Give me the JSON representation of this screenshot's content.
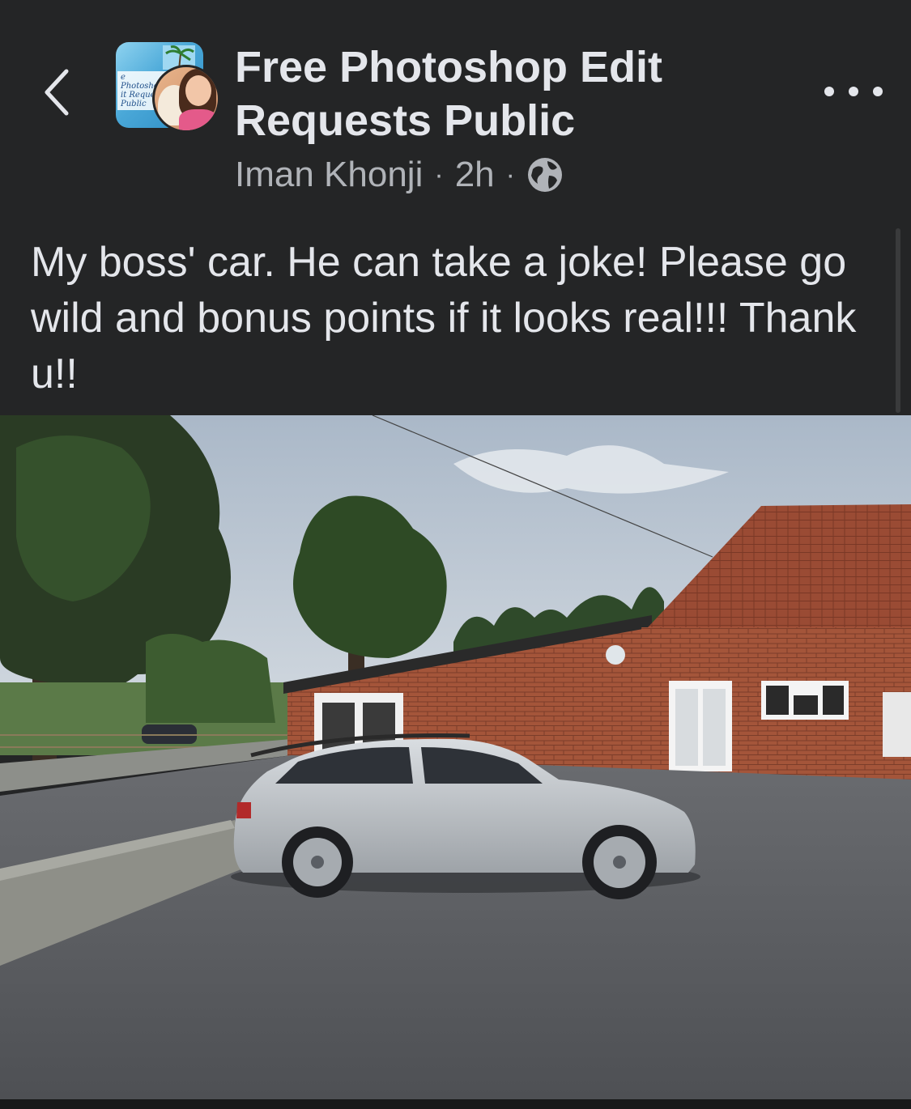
{
  "header": {
    "back_icon": "chevron-left-icon",
    "group_name": "Free Photoshop Edit Requests Public",
    "group_avatar_text": "e Photoshop\nit Request\nPublic",
    "author": "Iman Khonji",
    "separator": "·",
    "time": "2h",
    "audience_icon": "globe-icon",
    "more_icon": "more-horizontal-icon"
  },
  "post": {
    "text": "My boss' car. He can take a joke! Please go wild and bonus points if it looks real!!! Thank u!!"
  },
  "colors": {
    "background": "#242526",
    "primary_text": "#e4e6eb",
    "secondary_text": "#b0b3b8"
  }
}
